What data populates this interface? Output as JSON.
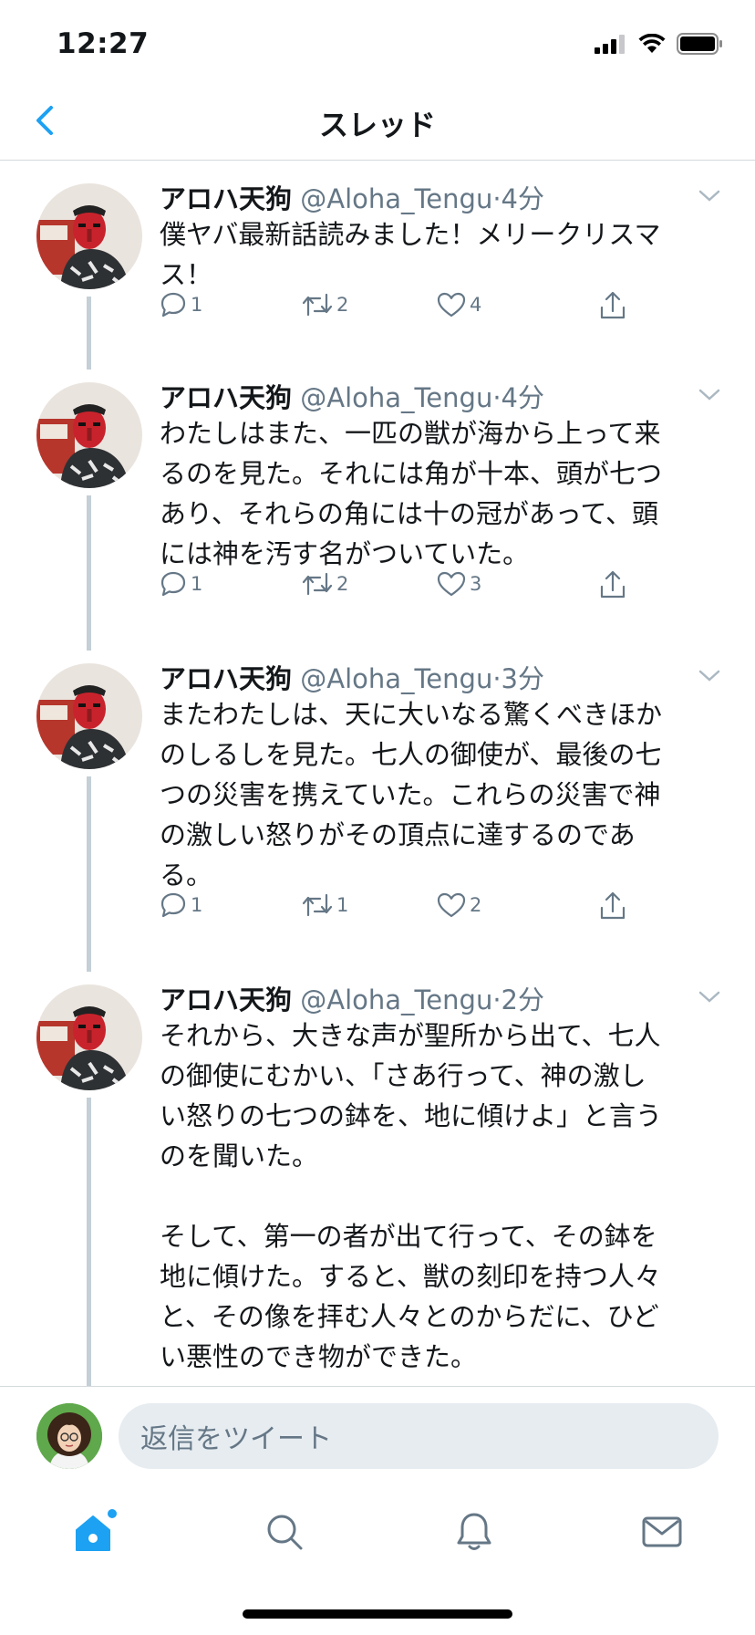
{
  "status_bar": {
    "time": "12:27"
  },
  "header": {
    "title": "スレッド"
  },
  "colors": {
    "accent": "#1da1f2",
    "secondary_text": "#657786",
    "thread_line": "#c4cfd6"
  },
  "tweets": [
    {
      "name": "アロハ天狗",
      "handle": "@Aloha_Tengu",
      "dot": "·",
      "time": "4分",
      "text": "僕ヤバ最新話読みました！メリークリスマ\nス！",
      "replies": "1",
      "retweets": "2",
      "likes": "4"
    },
    {
      "name": "アロハ天狗",
      "handle": "@Aloha_Tengu",
      "dot": "·",
      "time": "4分",
      "text": "わたしはまた、一匹の獣が海から上って来\nるのを見た。それには角が十本、頭が七つ\nあり、それらの角には十の冠があって、頭\nには神を汚す名がついていた。",
      "replies": "1",
      "retweets": "2",
      "likes": "3"
    },
    {
      "name": "アロハ天狗",
      "handle": "@Aloha_Tengu",
      "dot": "·",
      "time": "3分",
      "text": "またわたしは、天に大いなる驚くべきほか\nのしるしを見た。七人の御使が、最後の七\nつの災害を携えていた。これらの災害で神\nの激しい怒りがその頂点に達するのであ\nる。",
      "replies": "1",
      "retweets": "1",
      "likes": "2"
    },
    {
      "name": "アロハ天狗",
      "handle": "@Aloha_Tengu",
      "dot": "·",
      "time": "2分",
      "text": "それから、大きな声が聖所から出て、七人\nの御使にむかい、「さあ行って、神の激し\nい怒りの七つの鉢を、地に傾けよ」と言う\nのを聞いた。\n\nそして、第一の者が出て行って、その鉢を\n地に傾けた。すると、獣の刻印を持つ人々\nと、その像を拝む人々とのからだに、ひど\nい悪性のでき物ができた。"
    }
  ],
  "reply": {
    "placeholder": "返信をツイート"
  },
  "tab_bar": {
    "items": [
      "home-icon",
      "search-icon",
      "notifications-icon",
      "messages-icon"
    ]
  }
}
